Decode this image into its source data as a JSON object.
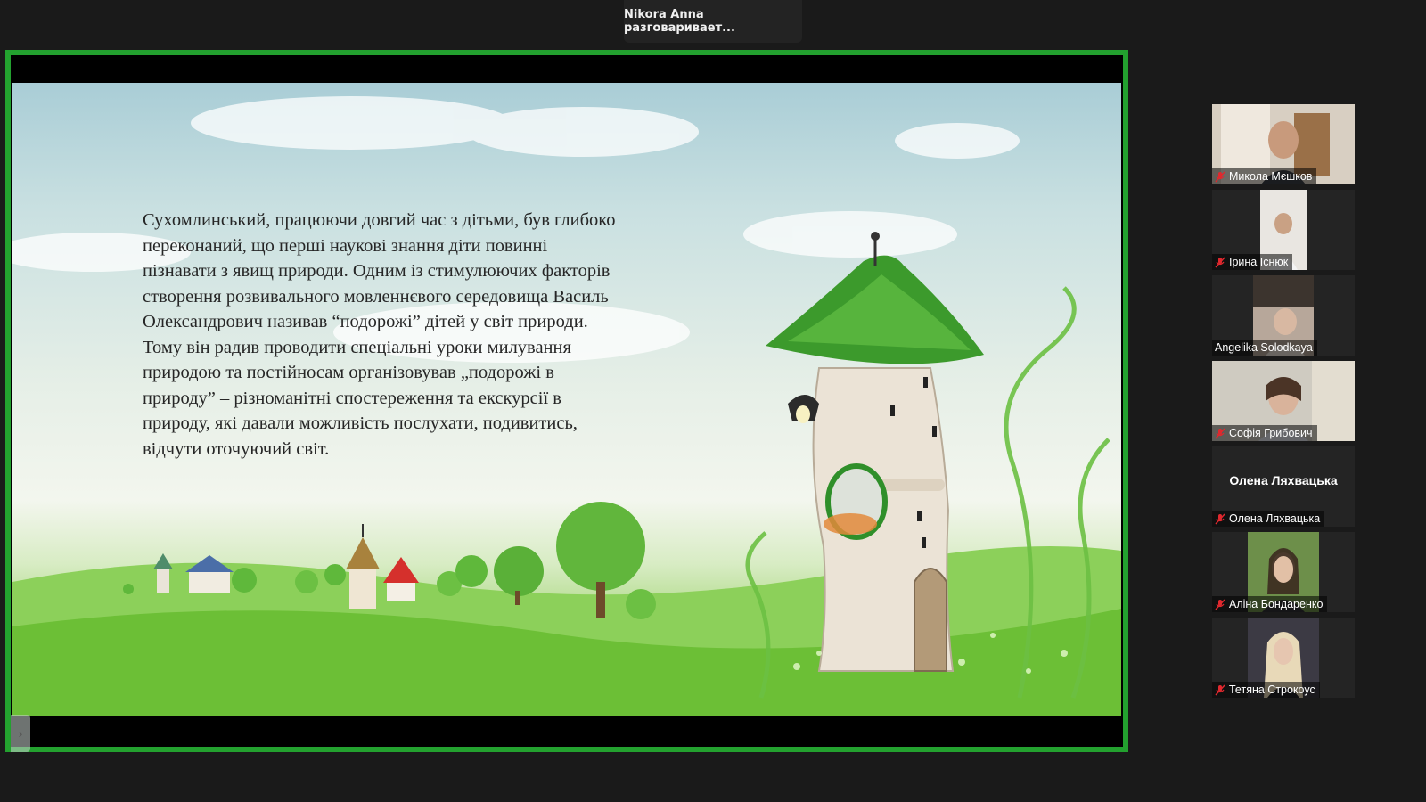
{
  "speaker_banner": "Nikora Anna разговаривает...",
  "slide": {
    "text": " Сухомлинський, працюючи довгий час з дітьми, був глибоко\nпереконаний, що перші наукові знання діти повинні\nпізнавати з явищ природи. Одним із стимулюючих факторів\nстворення розвивального мовленнєвого середовища Василь\nОлександрович називав “подорожі” дітей у світ природи.\nТому він радив проводити спеціальні уроки милування\nприродою та постійносам організовував „подорожі в\nприроду” – різноманітні спостереження та екскурсії в\nприроду, які давали можливість послухати, подивитись,\nвідчути оточуючий світ."
  },
  "participants": [
    {
      "name": "Микола Мєшков",
      "muted": true,
      "video": true
    },
    {
      "name": "Ірина Існюк",
      "muted": true,
      "video": true
    },
    {
      "name": "Angelika Solodkaya",
      "muted": false,
      "video": true
    },
    {
      "name": "Софія Грибович",
      "muted": true,
      "video": true
    },
    {
      "name": "Олена Ляхвацька",
      "display_name": "Олена Ляхвацька",
      "muted": true,
      "video": false
    },
    {
      "name": "Аліна Бондаренко",
      "muted": true,
      "video": true
    },
    {
      "name": "Тетяна Строкоус",
      "muted": true,
      "video": true
    }
  ],
  "colors": {
    "active_speaker_border": "#23a12f",
    "mic_off": "#e0282e",
    "background": "#1a1a1a"
  },
  "icons": {
    "mic_off": "mic-off-icon",
    "collapse": "chevron-right-icon"
  }
}
